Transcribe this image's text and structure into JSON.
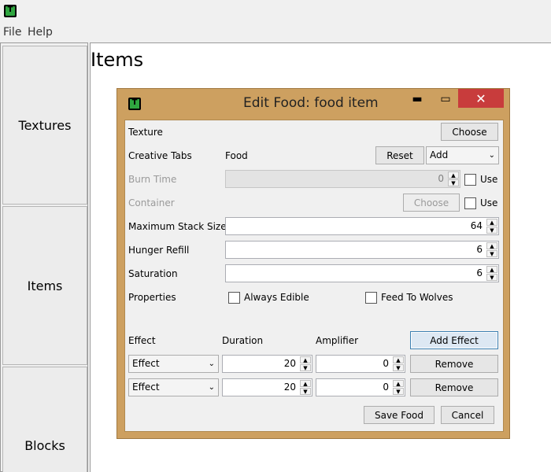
{
  "menu": {
    "file": "File",
    "help": "Help"
  },
  "sidebar": {
    "textures": "Textures",
    "items": "Items",
    "blocks": "Blocks"
  },
  "page": {
    "title": "Items"
  },
  "dialog": {
    "title": "Edit Food: food item",
    "texture": {
      "label": "Texture",
      "choose": "Choose"
    },
    "creative_tabs": {
      "label": "Creative Tabs",
      "value": "Food",
      "reset": "Reset",
      "add": "Add"
    },
    "burn_time": {
      "label": "Burn Time",
      "value": "0",
      "use": "Use"
    },
    "container": {
      "label": "Container",
      "choose": "Choose",
      "use": "Use"
    },
    "max_stack": {
      "label": "Maximum Stack Size",
      "value": "64"
    },
    "hunger": {
      "label": "Hunger Refill",
      "value": "6"
    },
    "saturation": {
      "label": "Saturation",
      "value": "6"
    },
    "properties": {
      "label": "Properties",
      "always_edible": "Always Edible",
      "feed_wolves": "Feed To Wolves"
    },
    "effects_header": {
      "effect": "Effect",
      "duration": "Duration",
      "amplifier": "Amplifier",
      "add": "Add Effect"
    },
    "effects": [
      {
        "effect": "Effect",
        "duration": "20",
        "amplifier": "0",
        "remove": "Remove"
      },
      {
        "effect": "Effect",
        "duration": "20",
        "amplifier": "0",
        "remove": "Remove"
      }
    ],
    "save": "Save Food",
    "cancel": "Cancel"
  }
}
